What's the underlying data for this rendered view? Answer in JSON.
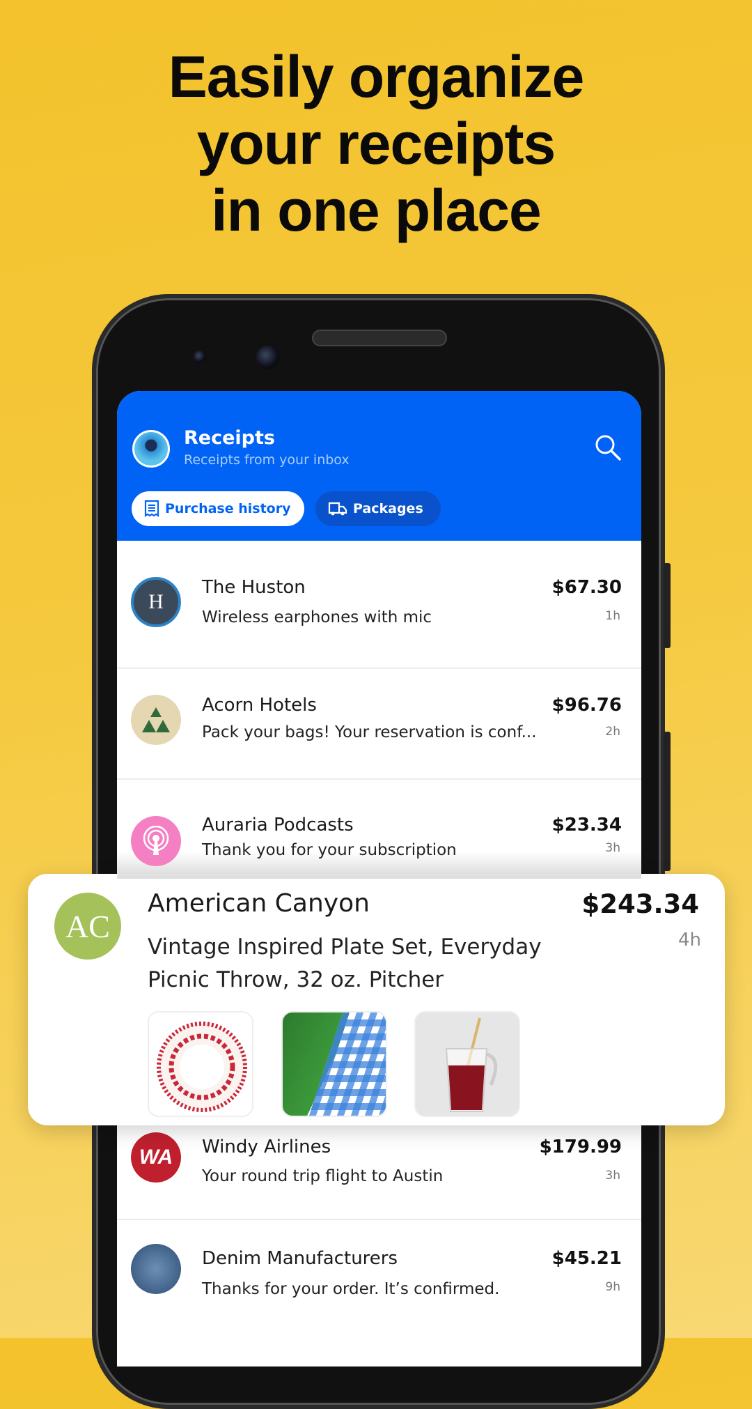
{
  "headline": [
    "Easily organize",
    "your receipts",
    "in one place"
  ],
  "colors": {
    "background": "#f3c22c",
    "header": "#0063f5",
    "accent": "#0063f5"
  },
  "header": {
    "title": "Receipts",
    "subtitle": "Receipts from your inbox",
    "search_icon": "search-icon",
    "tabs": [
      {
        "label": "Purchase history",
        "icon": "receipt-icon",
        "active": true
      },
      {
        "label": "Packages",
        "icon": "truck-icon",
        "active": false
      }
    ]
  },
  "receipts": [
    {
      "merchant": "The Huston",
      "description": "Wireless earphones with mic",
      "price": "$67.30",
      "time": "1h",
      "logo": "H"
    },
    {
      "merchant": "Acorn Hotels",
      "description": "Pack your bags! Your reservation is conf...",
      "price": "$96.76",
      "time": "2h"
    },
    {
      "merchant": "Auraria Podcasts",
      "description": "Thank you for your subscription",
      "price": "$23.34",
      "time": "3h"
    },
    {
      "merchant": "Windy Airlines",
      "description": "Your round trip flight to Austin",
      "price": "$179.99",
      "time": "3h",
      "logo": "WA"
    },
    {
      "merchant": "Denim Manufacturers",
      "description": "Thanks for your order. It’s confirmed.",
      "price": "$45.21",
      "time": "9h"
    }
  ],
  "featured": {
    "merchant": "American Canyon",
    "logo": "AC",
    "description": "Vintage Inspired Plate Set, Everyday Picnic Throw, 32 oz. Pitcher",
    "price": "$243.34",
    "time": "4h",
    "items": [
      "plate",
      "picnic-throw",
      "pitcher"
    ]
  }
}
